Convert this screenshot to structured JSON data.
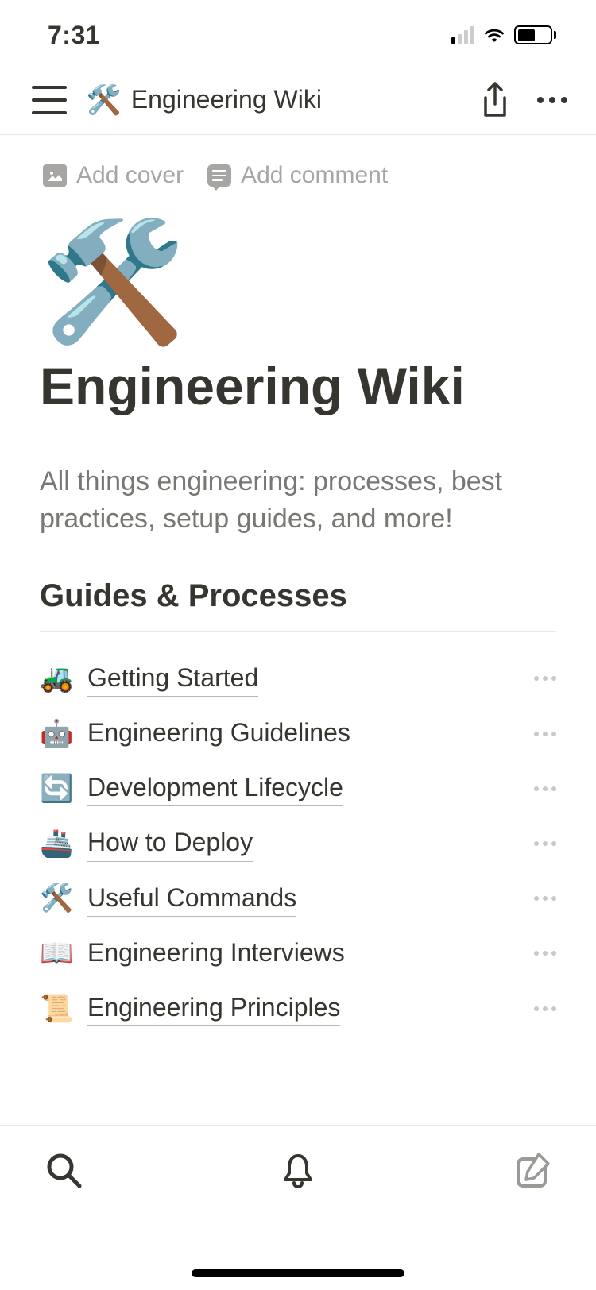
{
  "status": {
    "time": "7:31"
  },
  "nav": {
    "icon": "🛠️",
    "title": "Engineering Wiki"
  },
  "page_actions": {
    "add_cover": "Add cover",
    "add_comment": "Add comment"
  },
  "page": {
    "icon": "🛠️",
    "title": "Engineering Wiki",
    "description": "All things engineering: processes, best practices, setup guides, and more!"
  },
  "section": {
    "heading": "Guides & Processes"
  },
  "items": [
    {
      "icon": "🚜",
      "label": "Getting Started"
    },
    {
      "icon": "🤖",
      "label": "Engineering Guidelines"
    },
    {
      "icon": "🔄",
      "label": "Development Lifecycle"
    },
    {
      "icon": "🚢",
      "label": "How to Deploy"
    },
    {
      "icon": "🛠️",
      "label": "Useful Commands"
    },
    {
      "icon": "📖",
      "label": "Engineering Interviews"
    },
    {
      "icon": "📜",
      "label": "Engineering Principles"
    }
  ]
}
